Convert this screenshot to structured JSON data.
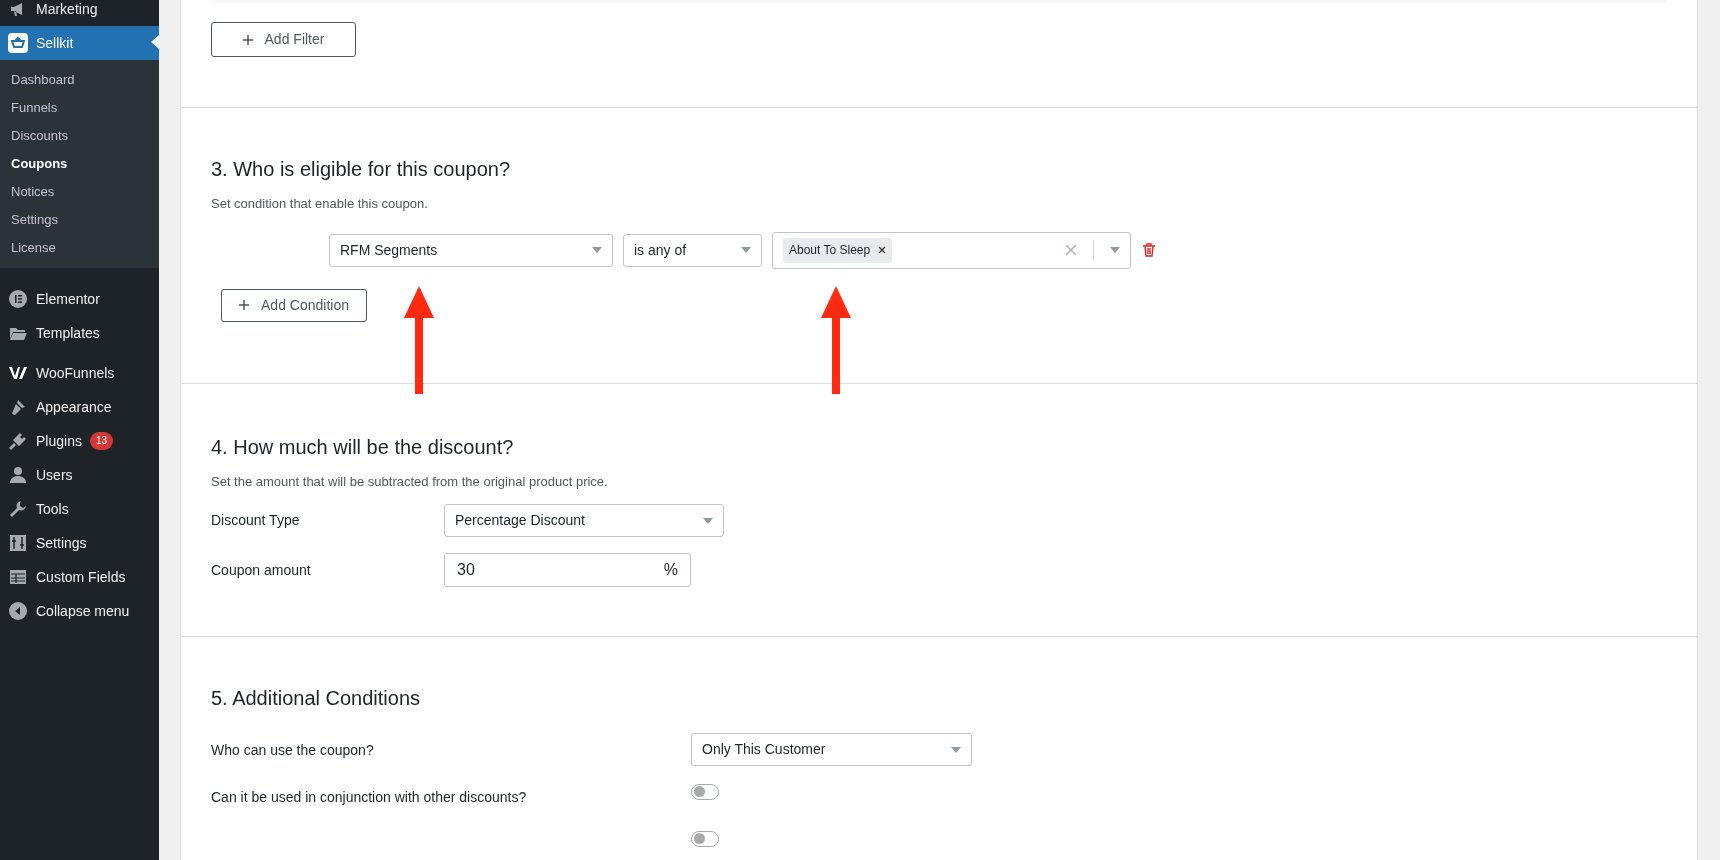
{
  "sidebar": {
    "items": [
      {
        "label": "Marketing",
        "selected": false
      },
      {
        "label": "Sellkit",
        "selected": true,
        "children": [
          {
            "label": "Dashboard",
            "selected": false
          },
          {
            "label": "Funnels",
            "selected": false
          },
          {
            "label": "Discounts",
            "selected": false
          },
          {
            "label": "Coupons",
            "selected": true
          },
          {
            "label": "Notices",
            "selected": false
          },
          {
            "label": "Settings",
            "selected": false
          },
          {
            "label": "License",
            "selected": false
          }
        ]
      },
      {
        "label": "Elementor",
        "selected": false
      },
      {
        "label": "Templates",
        "selected": false
      },
      {
        "label": "WooFunnels",
        "selected": false
      },
      {
        "label": "Appearance",
        "selected": false
      },
      {
        "label": "Plugins",
        "selected": false,
        "badge": "13"
      },
      {
        "label": "Users",
        "selected": false
      },
      {
        "label": "Tools",
        "selected": false
      },
      {
        "label": "Settings",
        "selected": false
      },
      {
        "label": "Custom Fields",
        "selected": false
      },
      {
        "label": "Collapse menu",
        "selected": false
      }
    ]
  },
  "filter_section": {
    "button": "Add Filter"
  },
  "eligibility_section": {
    "title": "3. Who is eligible for this coupon?",
    "description": "Set condition that enable this coupon.",
    "condition": {
      "field": "RFM Segments",
      "operator": "is any of",
      "tags": [
        "About To Sleep"
      ]
    },
    "button": "Add Condition"
  },
  "discount_section": {
    "title": "4. How much will be the discount?",
    "description": "Set the amount that will be subtracted from the original product price.",
    "fields": [
      {
        "kind": "select",
        "label": "Discount Type",
        "value": "Percentage Discount"
      },
      {
        "kind": "input",
        "label": "Coupon amount",
        "value": "30",
        "suffix": "%"
      }
    ]
  },
  "conditions_section": {
    "title": "5. Additional Conditions",
    "fields": [
      {
        "kind": "select",
        "label": "Who can use the coupon?",
        "value": "Only This Customer"
      },
      {
        "kind": "toggle",
        "label": "Can it be used in conjunction with other discounts?",
        "on": false
      },
      {
        "kind": "toggle",
        "on": false
      }
    ]
  }
}
